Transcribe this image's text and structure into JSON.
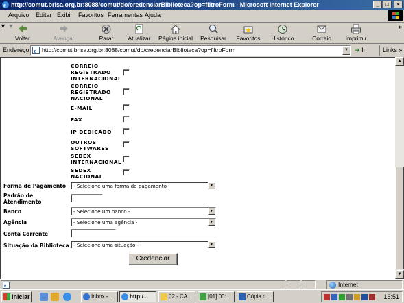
{
  "window": {
    "title": "http://comut.brisa.org.br:8088/comut/do/credenciarBiblioteca?op=filtroForm - Microsoft Internet Explorer",
    "controls": [
      "_",
      "□",
      "×"
    ]
  },
  "menu": [
    "Arquivo",
    "Editar",
    "Exibir",
    "Favoritos",
    "Ferramentas",
    "Ajuda"
  ],
  "toolbar": {
    "back": "Voltar",
    "forward": "Avançar",
    "stop": "Parar",
    "refresh": "Atualizar",
    "home": "Página inicial",
    "search": "Pesquisar",
    "favorites": "Favoritos",
    "history": "Histórico",
    "mail": "Correio",
    "print": "Imprimir",
    "more": "»"
  },
  "address": {
    "label": "Endereço",
    "url": "http://comut.brisa.org.br:8088/comut/do/credenciarBiblioteca?op=filtroForm",
    "go": "Ir",
    "links": "Links »"
  },
  "services": [
    {
      "line1": "CORREIO",
      "line2": "REGISTRADO",
      "line3": "INTERNACIONAL",
      "checked": false
    },
    {
      "line1": "CORREIO",
      "line2": "REGISTRADO",
      "line3": "NACIONAL",
      "checked": false
    },
    {
      "line1": "E-MAIL",
      "line2": "",
      "line3": "",
      "checked": false
    },
    {
      "line1": "FAX",
      "line2": "",
      "line3": "",
      "checked": false
    },
    {
      "line1": "IP DEDICADO",
      "line2": "",
      "line3": "",
      "checked": false
    },
    {
      "line1": "OUTROS",
      "line2": "SOFTWARES",
      "line3": "",
      "checked": false
    },
    {
      "line1": "SEDEX",
      "line2": "INTERNACIONAL",
      "line3": "",
      "checked": false
    },
    {
      "line1": "SEDEX",
      "line2": "NACIONAL",
      "line3": "",
      "checked": false
    }
  ],
  "form": {
    "payment_label": "Forma de Pagamento",
    "payment_value": "- Selecione uma forma de pagamento -",
    "schedule_label_1": "Padrão de",
    "schedule_label_2": "Atendimento",
    "schedule_value": "",
    "bank_label": "Banco",
    "bank_value": "- Selecione um banco -",
    "agency_label": "Agência",
    "agency_value": "- Selecione uma agência -",
    "account_label": "Conta Corrente",
    "account_value": "",
    "status_label": "Situação da Biblioteca",
    "status_value": "- Selecione uma situação -",
    "submit": "Credenciar"
  },
  "statusbar": {
    "zone": "Internet"
  },
  "taskbar": {
    "start": "Iniciar",
    "tasks": [
      "Inbox - ...",
      "http:/...",
      "02 - CA...",
      "[01] 00:...",
      "Cópia d..."
    ],
    "clock": "16:51"
  }
}
